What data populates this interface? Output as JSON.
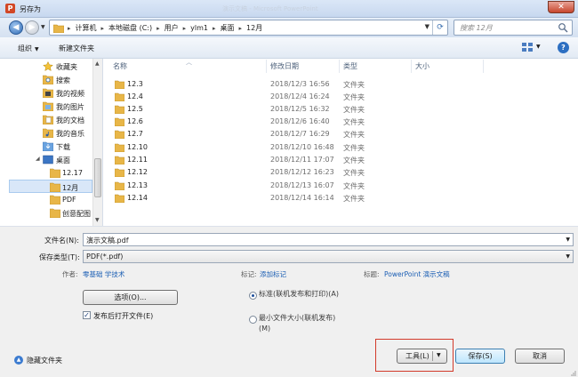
{
  "window": {
    "title": "另存为",
    "ghost_title": "演示文稿 - Microsoft PowerPoint",
    "app_icon_letter": "P",
    "close_glyph": "✕"
  },
  "address_bar": {
    "back_glyph": "◀",
    "forward_glyph": "▶",
    "breadcrumbs": [
      "计算机",
      "本地磁盘 (C:)",
      "用户",
      "ylm1",
      "桌面",
      "12月"
    ],
    "refresh_icon": "refresh-icon"
  },
  "search": {
    "placeholder": "搜索 12月"
  },
  "toolbar": {
    "organize_label": "组织",
    "new_folder_label": "新建文件夹",
    "help_glyph": "?"
  },
  "nav_pane": {
    "items": [
      {
        "label": "收藏夹",
        "icon": "star-icon"
      },
      {
        "label": "搜索",
        "icon": "search-folder-icon"
      },
      {
        "label": "我的视频",
        "icon": "video-folder-icon"
      },
      {
        "label": "我的图片",
        "icon": "picture-folder-icon"
      },
      {
        "label": "我的文档",
        "icon": "document-folder-icon"
      },
      {
        "label": "我的音乐",
        "icon": "music-folder-icon"
      },
      {
        "label": "下载",
        "icon": "download-folder-icon"
      },
      {
        "label": "桌面",
        "icon": "desktop-folder-icon"
      },
      {
        "label": "12.17",
        "icon": "folder-icon"
      },
      {
        "label": "12月",
        "icon": "folder-icon",
        "selected": true
      },
      {
        "label": "PDF",
        "icon": "folder-icon"
      },
      {
        "label": "创意配图",
        "icon": "folder-icon"
      }
    ]
  },
  "file_list": {
    "columns": [
      "名称",
      "修改日期",
      "类型",
      "大小"
    ],
    "rows": [
      {
        "name": "12.3",
        "date": "2018/12/3 16:56",
        "type": "文件夹"
      },
      {
        "name": "12.4",
        "date": "2018/12/4 16:24",
        "type": "文件夹"
      },
      {
        "name": "12.5",
        "date": "2018/12/5 16:32",
        "type": "文件夹"
      },
      {
        "name": "12.6",
        "date": "2018/12/6 16:40",
        "type": "文件夹"
      },
      {
        "name": "12.7",
        "date": "2018/12/7 16:29",
        "type": "文件夹"
      },
      {
        "name": "12.10",
        "date": "2018/12/10 16:48",
        "type": "文件夹"
      },
      {
        "name": "12.11",
        "date": "2018/12/11 17:07",
        "type": "文件夹"
      },
      {
        "name": "12.12",
        "date": "2018/12/12 16:23",
        "type": "文件夹"
      },
      {
        "name": "12.13",
        "date": "2018/12/13 16:07",
        "type": "文件夹"
      },
      {
        "name": "12.14",
        "date": "2018/12/14 16:14",
        "type": "文件夹"
      }
    ]
  },
  "form": {
    "filename_label": "文件名(N):",
    "filename_value": "演示文稿.pdf",
    "filetype_label": "保存类型(T):",
    "filetype_value": "PDF(*.pdf)",
    "authors_label": "作者:",
    "authors_value": "零基础 学技术",
    "tags_label": "标记:",
    "tags_value": "添加标记",
    "title_label": "标题:",
    "title_value": "PowerPoint 演示文稿",
    "options_button": "选项(O)...",
    "open_after_publish": {
      "label": "发布后打开文件(E)",
      "checked": true,
      "check_glyph": "✓"
    },
    "optimize": {
      "standard": {
        "label": "标准(联机发布和打印)(A)",
        "selected": true
      },
      "minimum": {
        "label": "最小文件大小(联机发布)(M)",
        "selected": false
      }
    },
    "hide_folders_label": "隐藏文件夹",
    "tools_label": "工具(L)",
    "save_label": "保存(S)",
    "cancel_label": "取消"
  },
  "colors": {
    "accent": "#1c5fb4",
    "folder": "#e8b648",
    "highlight_box": "#d23a2a",
    "selection": "#d9e7f8"
  }
}
